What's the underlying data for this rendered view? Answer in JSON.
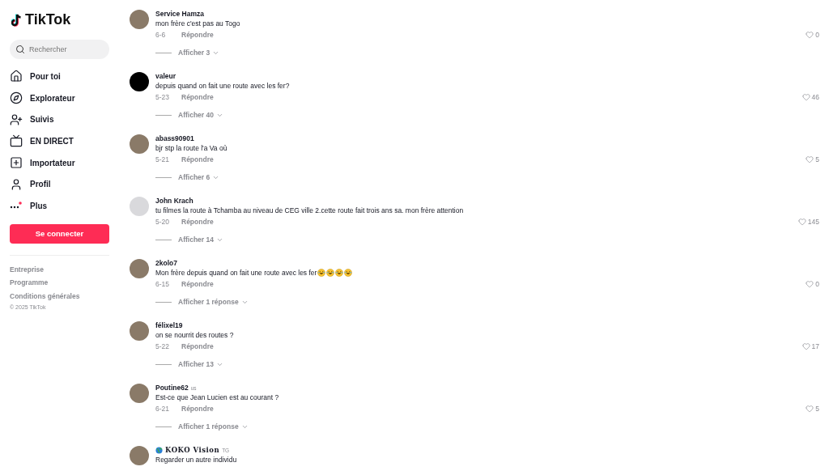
{
  "sidebar": {
    "logo": "TikTok",
    "search": {
      "placeholder": "Rechercher"
    },
    "nav": [
      {
        "kind": "home",
        "label": "Pour toi",
        "selected": false
      },
      {
        "kind": "compass",
        "label": "Explorateur",
        "selected": false
      },
      {
        "kind": "following",
        "label": "Suivis",
        "selected": false
      },
      {
        "kind": "live",
        "label": "EN DIRECT",
        "selected": false
      },
      {
        "kind": "upload",
        "label": "Importateur",
        "selected": false
      },
      {
        "kind": "profile",
        "label": "Profil",
        "selected": false
      },
      {
        "kind": "more",
        "label": "Plus",
        "selected": false
      }
    ],
    "login_button": "Se connecter",
    "footer_links": [
      "Entreprise",
      "Programme",
      "Conditions générales"
    ],
    "copyright": "© 2025 TikTok"
  },
  "comments": [
    {
      "avatar": {
        "kind": "photo"
      },
      "user": "Service Hamza",
      "text": "mon frère c'est pas au Togo",
      "date": "6-6",
      "reply": "Répondre",
      "likes": "0",
      "replies": "Afficher 3"
    },
    {
      "avatar": {
        "kind": "dark"
      },
      "user": "valeur",
      "text": "depuis quand on fait une route avec les fer?",
      "date": "5-23",
      "reply": "Répondre",
      "likes": "46",
      "replies": "Afficher 40"
    },
    {
      "avatar": {
        "kind": "photo"
      },
      "user": "abass90901",
      "text": "bjr stp la route l'a Va où",
      "date": "5-21",
      "reply": "Répondre",
      "likes": "5",
      "replies": "Afficher 6"
    },
    {
      "avatar": {
        "kind": "default"
      },
      "user": "John Krach",
      "text": "tu filmes la route à Tchamba au niveau de CEG ville 2.cette route fait trois ans sa. mon frère attention",
      "date": "5-20",
      "reply": "Répondre",
      "likes": "145",
      "replies": "Afficher 14"
    },
    {
      "avatar": {
        "kind": "photo"
      },
      "user": "2kolo7",
      "text": "Mon frère depuis quand on fait une route avec les fer",
      "emojis": [
        {
          "kind": "laughing"
        },
        {
          "kind": "laughing"
        },
        {
          "kind": "laughing"
        },
        {
          "kind": "laughing"
        }
      ],
      "date": "6-15",
      "reply": "Répondre",
      "likes": "0",
      "replies": "Afficher 1 réponse"
    },
    {
      "avatar": {
        "kind": "photo"
      },
      "user": "félixel19",
      "text": "on se nourrit des routes ?",
      "date": "5-22",
      "reply": "Répondre",
      "likes": "17",
      "replies": "Afficher 13"
    },
    {
      "avatar": {
        "kind": "photo"
      },
      "user": "Poutine62",
      "region": "us",
      "text": "Est-ce que Jean Lucien est au courant ?",
      "date": "6-21",
      "reply": "Répondre",
      "likes": "5",
      "replies": "Afficher 1 réponse"
    },
    {
      "avatar": {
        "kind": "photo"
      },
      "user": "KOKO Vision",
      "decorated": true,
      "region": "TG",
      "text": "Regarder un autre individu"
    }
  ]
}
